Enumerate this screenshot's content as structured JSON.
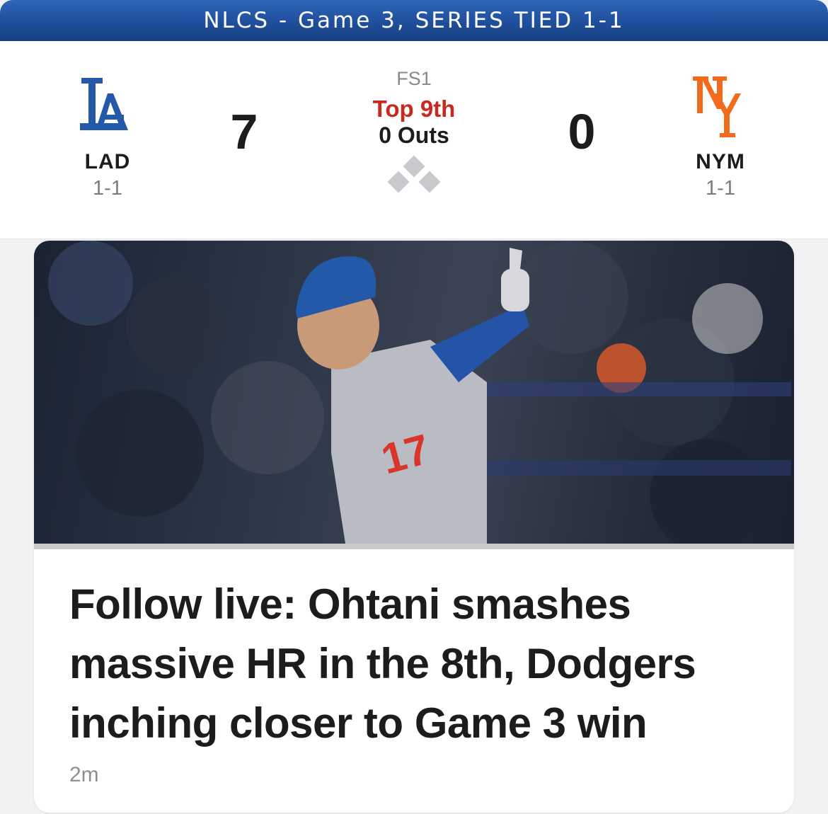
{
  "banner": {
    "text": "NLCS - Game 3, SERIES TIED 1-1"
  },
  "scoreboard": {
    "away": {
      "abbr": "LAD",
      "record": "1-1",
      "score": "7",
      "logo_icon": "dodgers-la-logo-icon",
      "color": "#2458a8"
    },
    "home": {
      "abbr": "NYM",
      "record": "1-1",
      "score": "0",
      "logo_icon": "mets-ny-logo-icon",
      "color": "#f26a1b"
    },
    "status": {
      "network": "FS1",
      "inning": "Top 9th",
      "outs": "0 Outs",
      "bases_occupied": {
        "first": false,
        "second": false,
        "third": false
      }
    }
  },
  "article": {
    "image_icon": "ohtani-celebration-photo",
    "headline": "Follow live: Ohtani smashes massive HR in the 8th, Dodgers inching closer to Game 3 win",
    "time": "2m"
  },
  "colors": {
    "banner": "#1f4e9c",
    "inning": "#c8281e",
    "base_empty": "#c9c9cd"
  }
}
